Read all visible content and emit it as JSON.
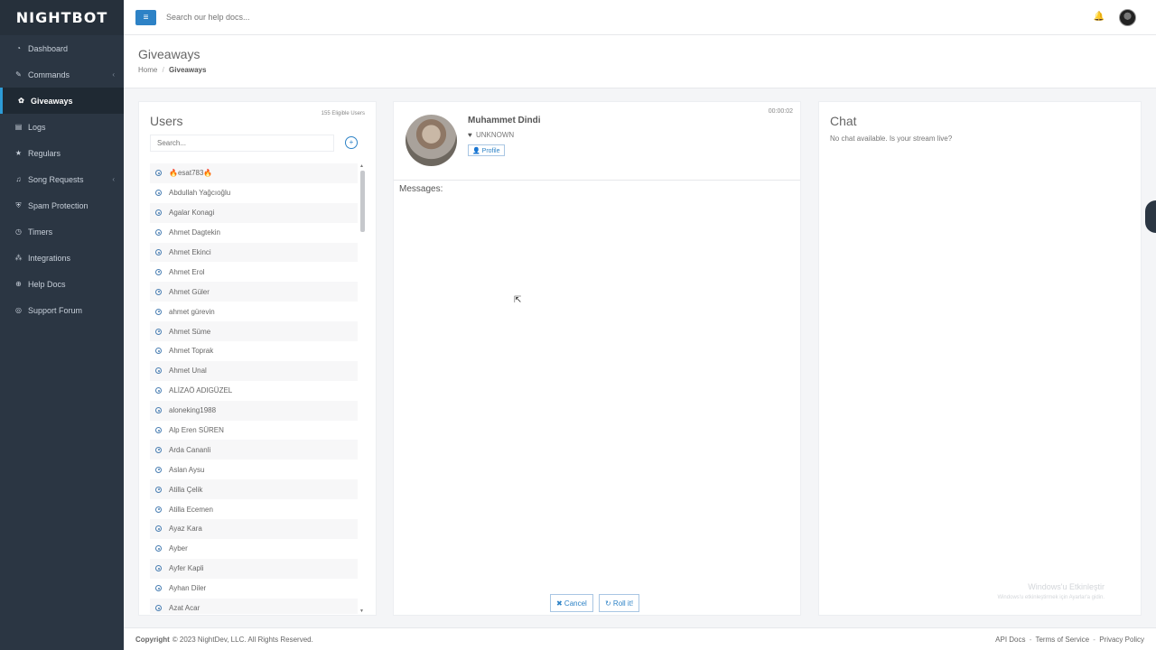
{
  "sidebar": {
    "logo": "NIGHTBOT",
    "items": [
      {
        "label": "Dashboard",
        "icon": "dashboard-icon",
        "glyph": "◔",
        "chevron": ""
      },
      {
        "label": "Commands",
        "icon": "wand-icon",
        "glyph": "✎",
        "chevron": "‹"
      },
      {
        "label": "Giveaways",
        "icon": "gift-icon",
        "glyph": "✿",
        "chevron": ""
      },
      {
        "label": "Logs",
        "icon": "logs-icon",
        "glyph": "▤",
        "chevron": ""
      },
      {
        "label": "Regulars",
        "icon": "star-icon",
        "glyph": "★",
        "chevron": ""
      },
      {
        "label": "Song Requests",
        "icon": "music-icon",
        "glyph": "♫",
        "chevron": "‹"
      },
      {
        "label": "Spam Protection",
        "icon": "shield-icon",
        "glyph": "⛨",
        "chevron": ""
      },
      {
        "label": "Timers",
        "icon": "clock-icon",
        "glyph": "◷",
        "chevron": ""
      },
      {
        "label": "Integrations",
        "icon": "cubes-icon",
        "glyph": "⁂",
        "chevron": ""
      },
      {
        "label": "Help Docs",
        "icon": "globe-icon",
        "glyph": "⊕",
        "chevron": ""
      },
      {
        "label": "Support Forum",
        "icon": "comments-icon",
        "glyph": "◎",
        "chevron": ""
      }
    ],
    "active_index": 2
  },
  "topbar": {
    "menu_glyph": "≡",
    "search_placeholder": "Search our help docs...",
    "bell_glyph": "🔔"
  },
  "header": {
    "title": "Giveaways",
    "breadcrumb_home": "Home",
    "breadcrumb_sep": "/",
    "breadcrumb_current": "Giveaways"
  },
  "users": {
    "title": "Users",
    "eligible": "155 Eligible Users",
    "search_placeholder": "Search...",
    "add_glyph": "+",
    "list": [
      "🔥esat783🔥",
      "Abdullah Yağcıoğlu",
      "Agalar Konagi",
      "Ahmet Dagtekin",
      "Ahmet Ekinci",
      "Ahmet Erol",
      "Ahmet Güler",
      "ahmet gürevin",
      "Ahmet Süme",
      "Ahmet Toprak",
      "Ahmet Unal",
      "ALİZAÖ ADIGÜZEL",
      "aloneking1988",
      "Alp Eren SÜREN",
      "Arda Cananli",
      "Aslan Aysu",
      "Atilla Çelik",
      "Atilla Ecemen",
      "Ayaz Kara",
      "Ayber",
      "Ayfer Kapli",
      "Ayhan Diler",
      "Azat Acar"
    ],
    "scroll_up": "▲",
    "scroll_down": "▼"
  },
  "winner": {
    "name": "Muhammet Dindi",
    "status": "UNKNOWN",
    "heart_glyph": "♥",
    "profile_label": "👤 Profile",
    "timer": "00:00:02",
    "messages_label": "Messages:",
    "cancel_label": "✖ Cancel",
    "roll_label": "↻ Roll it!"
  },
  "chat": {
    "title": "Chat",
    "empty_text": "No chat available. Is your stream live?",
    "watermark": "Windows'u Etkinleştir",
    "watermark_sub": "Windows'u etkinleştirmek için Ayarlar'a gidin."
  },
  "footer": {
    "copy_bold": "Copyright",
    "copy_text": "© 2023 NightDev, LLC. All Rights Reserved.",
    "links": [
      "API Docs",
      "Terms of Service",
      "Privacy Policy"
    ],
    "link_sep": "-"
  }
}
